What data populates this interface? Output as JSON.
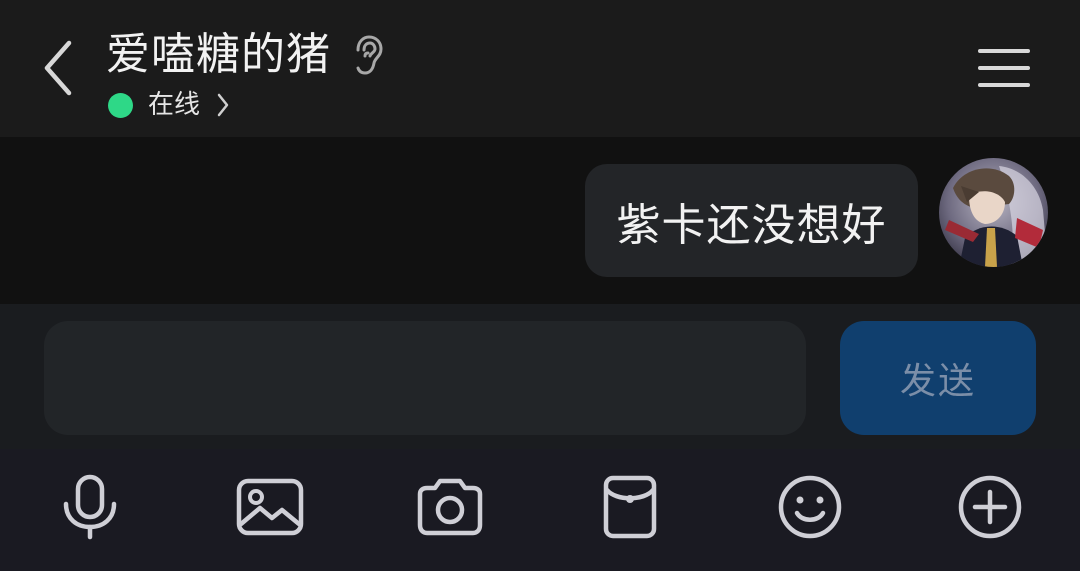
{
  "header": {
    "contact_name": "爱嗑糖的猪",
    "status": "在线",
    "status_color": "#2ed887",
    "icons": {
      "back": "chevron-left-icon",
      "listen_mode": "ear-icon",
      "status_more": "chevron-right-icon",
      "menu": "hamburger-menu-icon"
    }
  },
  "messages": [
    {
      "sender": "self",
      "text": "紫卡还没想好",
      "avatar": "avatar-image"
    }
  ],
  "composer": {
    "input_value": "",
    "input_placeholder": "",
    "send_label": "发送",
    "send_color": "#103f6e"
  },
  "toolbar": {
    "items": [
      {
        "icon": "microphone-icon"
      },
      {
        "icon": "image-icon"
      },
      {
        "icon": "camera-icon"
      },
      {
        "icon": "red-packet-icon"
      },
      {
        "icon": "emoji-icon"
      },
      {
        "icon": "plus-circle-icon"
      }
    ]
  }
}
